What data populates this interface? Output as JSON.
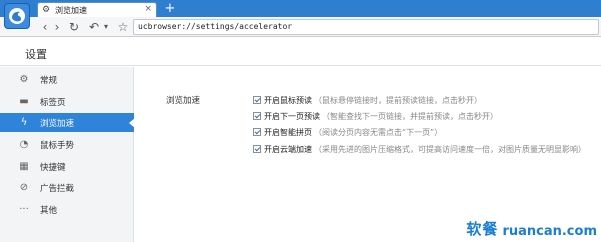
{
  "browser": {
    "tab": {
      "title": "浏览加速",
      "icon": "gear-icon",
      "close": "×"
    },
    "new_tab": "+",
    "address": "ucbrowser://settings/accelerator",
    "nav_icons": {
      "back": "‹",
      "forward": "›",
      "reload": "↻",
      "history": "↶",
      "history_dropdown": "▾",
      "favorite": "☆"
    }
  },
  "settings": {
    "title": "设置",
    "sidebar": [
      {
        "label": "常规",
        "icon": "gear-icon",
        "glyph": "⚙",
        "active": false
      },
      {
        "label": "标签页",
        "icon": "tab-icon",
        "glyph": "▬",
        "active": false
      },
      {
        "label": "浏览加速",
        "icon": "lightning-icon",
        "glyph": "ϟ",
        "active": true
      },
      {
        "label": "鼠标手势",
        "icon": "mouse-gesture-icon",
        "glyph": "◔",
        "active": false
      },
      {
        "label": "快捷键",
        "icon": "keyboard-icon",
        "glyph": "▦",
        "active": false
      },
      {
        "label": "广告拦截",
        "icon": "block-icon",
        "glyph": "⊘",
        "active": false
      },
      {
        "label": "其他",
        "icon": "more-icon",
        "glyph": "···",
        "active": false
      }
    ],
    "section": {
      "label": "浏览加速",
      "options": [
        {
          "label": "开启鼠标预读",
          "desc": "（鼠标悬停链接时，提前预读链接，点击秒开）",
          "checked": true
        },
        {
          "label": "开启下一页预读",
          "desc": "（智能查找下一页链接，并提前预读，点击秒开）",
          "checked": true
        },
        {
          "label": "开启智能拼页",
          "desc": "（阅读分页内容无需点击“下一页”）",
          "checked": true
        },
        {
          "label": "开启云端加速",
          "desc": "（采用先进的图片压缩格式，可提高访问速度一倍，对图片质量无明显影响）",
          "checked": true
        }
      ]
    }
  },
  "watermark": {
    "cn": "软餐",
    "en": "ruancan.com"
  },
  "colors": {
    "titlebar": "#2f7fd0",
    "accent": "#2f83d9",
    "watermark": "#1a7fd0"
  }
}
